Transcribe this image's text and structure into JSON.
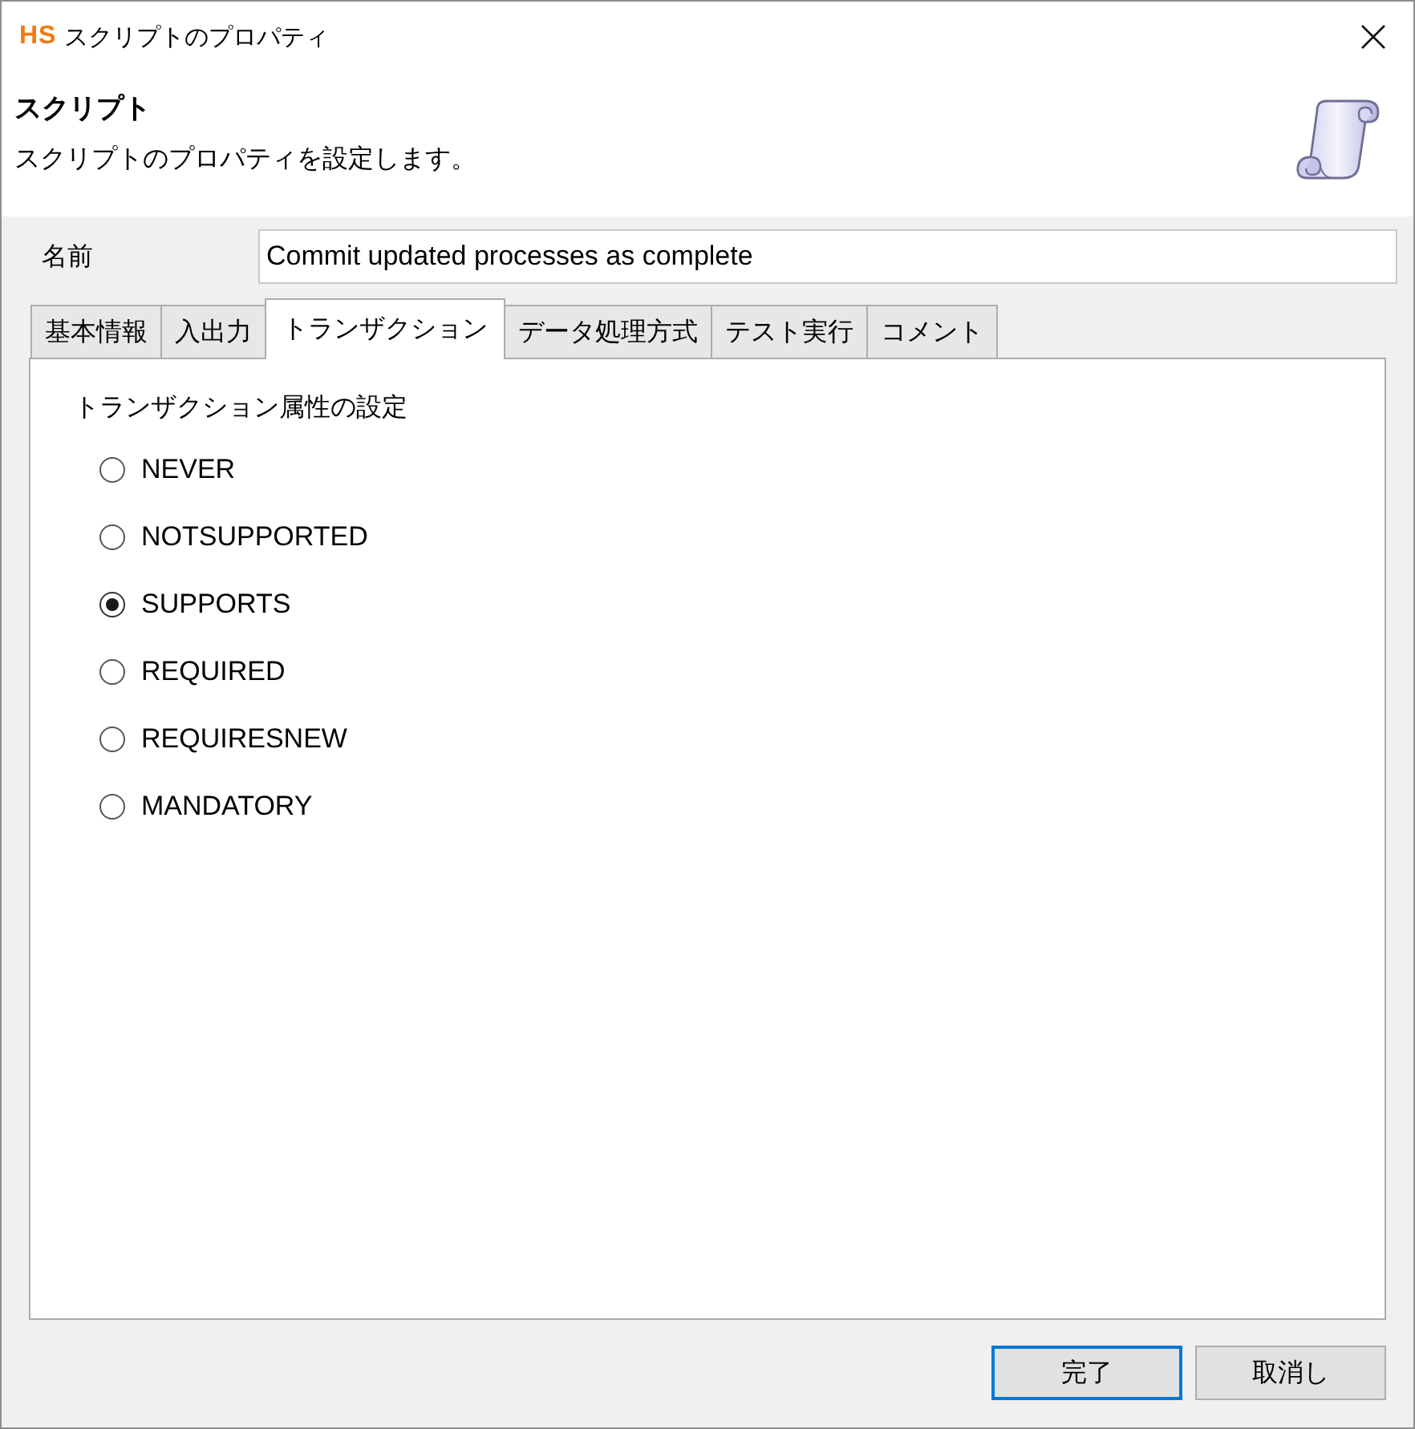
{
  "window": {
    "logo": "HS",
    "title": "スクリプトのプロパティ"
  },
  "header": {
    "title": "スクリプト",
    "description": "スクリプトのプロパティを設定します。"
  },
  "name_field": {
    "label": "名前",
    "value": "Commit updated processes as complete"
  },
  "tabs": [
    {
      "label": "基本情報",
      "selected": false
    },
    {
      "label": "入出力",
      "selected": false
    },
    {
      "label": "トランザクション",
      "selected": true
    },
    {
      "label": "データ処理方式",
      "selected": false
    },
    {
      "label": "テスト実行",
      "selected": false
    },
    {
      "label": "コメント",
      "selected": false
    }
  ],
  "transaction": {
    "group_label": "トランザクション属性の設定",
    "options": [
      {
        "label": "NEVER",
        "selected": false
      },
      {
        "label": "NOTSUPPORTED",
        "selected": false
      },
      {
        "label": "SUPPORTS",
        "selected": true
      },
      {
        "label": "REQUIRED",
        "selected": false
      },
      {
        "label": "REQUIRESNEW",
        "selected": false
      },
      {
        "label": "MANDATORY",
        "selected": false
      }
    ]
  },
  "buttons": [
    {
      "label": "完了",
      "default": true
    },
    {
      "label": "取消し",
      "default": false
    }
  ]
}
